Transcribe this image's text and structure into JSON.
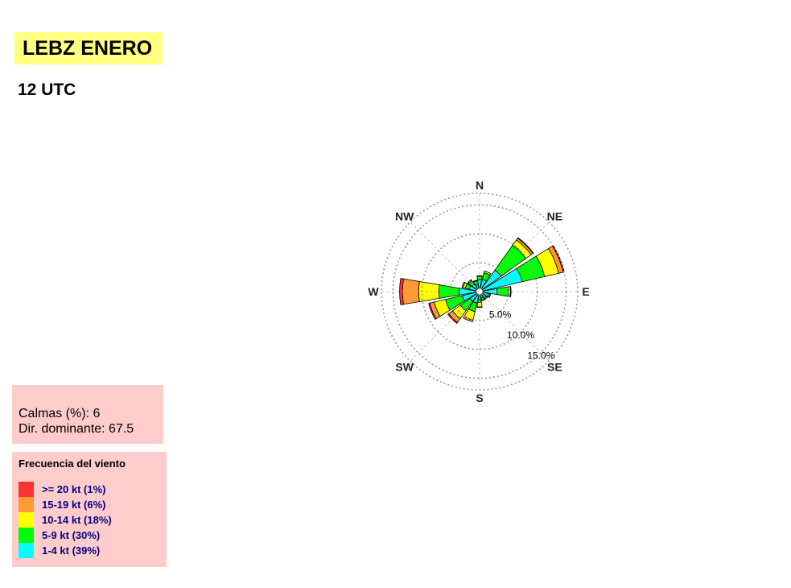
{
  "header": {
    "title": "LEBZ ENERO",
    "subtitle": "12 UTC"
  },
  "summary": {
    "calm_line": "Calmas (%): 6",
    "dominant_line": "Dir. dominante:  67.5"
  },
  "legend": {
    "title": "Frecuencia del viento",
    "items": [
      {
        "label": ">= 20 kt (1%)",
        "color": "#ff3333"
      },
      {
        "label": "15-19 kt (6%)",
        "color": "#ff9933"
      },
      {
        "label": "10-14 kt (18%)",
        "color": "#ffff00"
      },
      {
        "label": "5-9 kt (30%)",
        "color": "#00ff00"
      },
      {
        "label": "1-4 kt (39%)",
        "color": "#00ffff"
      }
    ]
  },
  "chart_data": {
    "type": "windrose",
    "compass_labels": [
      "N",
      "NE",
      "E",
      "SE",
      "S",
      "SW",
      "W",
      "NW"
    ],
    "ring_values": [
      5,
      10,
      15
    ],
    "ring_labels": [
      "5.0%",
      "10.0%",
      "15.0%"
    ],
    "rmax": 17,
    "directions_deg": [
      0,
      22.5,
      45,
      67.5,
      90,
      112.5,
      135,
      157.5,
      180,
      202.5,
      225,
      247.5,
      270,
      292.5,
      315,
      337.5
    ],
    "series": [
      {
        "name": "1-4 kt",
        "color": "#00ffff",
        "values": [
          1.5,
          1.6,
          4.0,
          7.0,
          2.5,
          1.0,
          0.8,
          0.6,
          0.8,
          1.5,
          1.5,
          2.5,
          3.0,
          1.3,
          1.0,
          0.7
        ]
      },
      {
        "name": "5-9 kt",
        "color": "#00ff00",
        "values": [
          0.6,
          1.2,
          5.3,
          4.0,
          2.0,
          0.3,
          0.2,
          0.4,
          0.5,
          1.5,
          2.0,
          3.0,
          3.5,
          0.7,
          0.7,
          0.7
        ]
      },
      {
        "name": "10-14 kt",
        "color": "#ffff00",
        "values": [
          0.1,
          0.3,
          1.1,
          2.5,
          0.3,
          0.1,
          0.1,
          0.1,
          0.8,
          1.5,
          1.7,
          2.0,
          3.5,
          0.4,
          0.2,
          0.1
        ]
      },
      {
        "name": "15-19 kt",
        "color": "#ff9933",
        "values": [
          0.0,
          0.0,
          0.4,
          0.8,
          0.1,
          0.0,
          0.0,
          0.0,
          0.1,
          0.3,
          0.8,
          0.8,
          2.8,
          0.2,
          0.1,
          0.0
        ]
      },
      {
        "name": ">= 20 kt",
        "color": "#ff3333",
        "values": [
          0.0,
          0.0,
          0.1,
          0.2,
          0.0,
          0.0,
          0.0,
          0.0,
          0.0,
          0.0,
          0.2,
          0.2,
          0.5,
          0.0,
          0.0,
          0.0
        ]
      }
    ]
  }
}
